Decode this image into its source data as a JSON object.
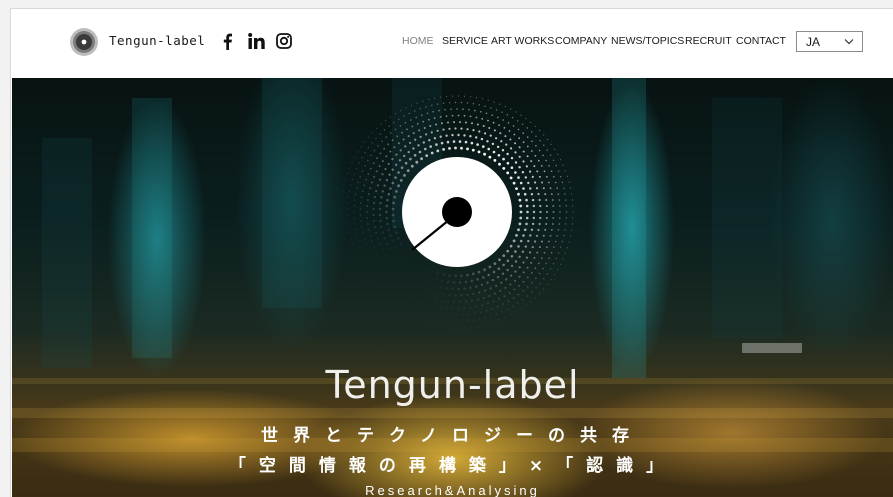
{
  "header": {
    "brand": "Tengun-label",
    "logo_icon": "vinyl-record-icon",
    "social": [
      {
        "name": "facebook",
        "icon": "facebook-icon"
      },
      {
        "name": "linkedin",
        "icon": "linkedin-icon"
      },
      {
        "name": "instagram",
        "icon": "instagram-icon"
      }
    ],
    "nav": [
      {
        "label": "HOME",
        "active": true
      },
      {
        "label": "SERVICE",
        "active": false
      },
      {
        "label": "ART WORKS",
        "active": false
      },
      {
        "label": "COMPANY",
        "active": false
      },
      {
        "label": "NEWS/TOPICS",
        "active": false
      },
      {
        "label": "RECRUIT",
        "active": false
      },
      {
        "label": "CONTACT",
        "active": false
      }
    ],
    "language": {
      "selected": "JA",
      "icon": "chevron-down-icon"
    }
  },
  "hero": {
    "title": "Tengun-label",
    "subtitle_1": "世界とテクノロジーの共存",
    "subtitle_2": "「空間情報の再構築」×「認識」",
    "subtitle_3": "Research&Analysing"
  },
  "colors": {
    "nav_text": "#1a1a1a",
    "nav_active": "#808080",
    "hero_text": "#ffffff"
  }
}
